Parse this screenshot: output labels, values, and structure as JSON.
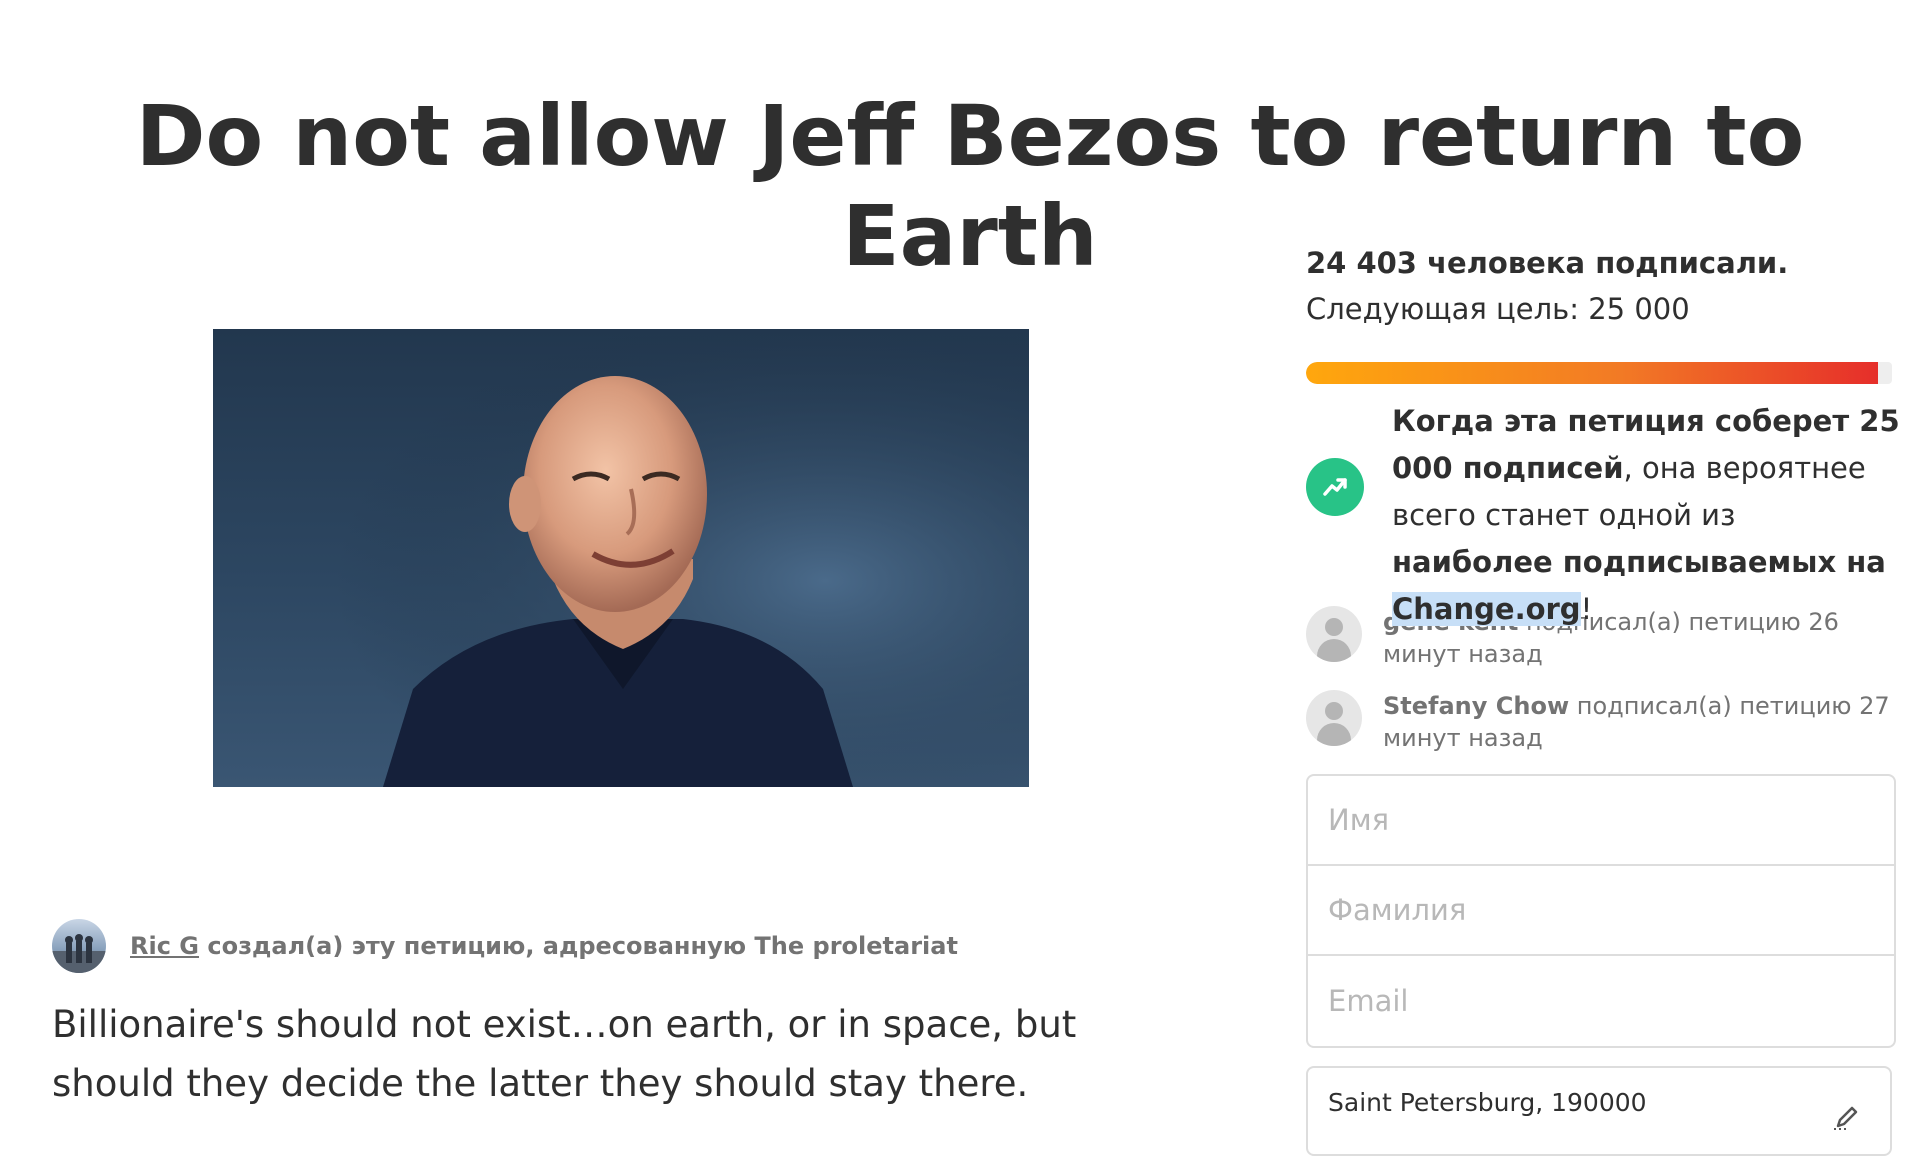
{
  "petition": {
    "title": "Do not allow Jeff Bezos to return to Earth",
    "author": {
      "name": "Ric G",
      "action": " создал(а) эту петицию, адресованную The proletariat"
    },
    "description": "Billionaire's should not exist…on earth, or in space, but should they decide the latter they should stay there."
  },
  "sidebar": {
    "signature_count": "24 403 человека подписали.",
    "next_goal": "Следующая цель: 25 000",
    "progress_fraction": 0.976,
    "goal_message": {
      "part1": "Когда эта петиция соберет ",
      "part2": "25 000 подписей",
      "part3": ", она вероятнее всего станет одной из ",
      "part4": "наиболее подписываемых на ",
      "part5": "Change.org",
      "part6": "!"
    },
    "recent_signers": [
      {
        "name": "gene kent",
        "text": " подписал(а) петицию 26 минут назад"
      },
      {
        "name": "Stefany Chow",
        "text": " подписал(а) петицию 27 минут назад"
      }
    ],
    "form": {
      "first_name_placeholder": "Имя",
      "last_name_placeholder": "Фамилия",
      "email_placeholder": "Email",
      "location": "Saint Petersburg, 190000"
    }
  },
  "colors": {
    "progress_start": "#ffa70d",
    "progress_end": "#e62e2a",
    "trend_icon_bg": "#28c387",
    "highlight": "#c7dff7"
  },
  "icons": {
    "trend": "trending-up-icon",
    "edit": "pencil-icon",
    "avatar": "default-avatar-icon"
  }
}
